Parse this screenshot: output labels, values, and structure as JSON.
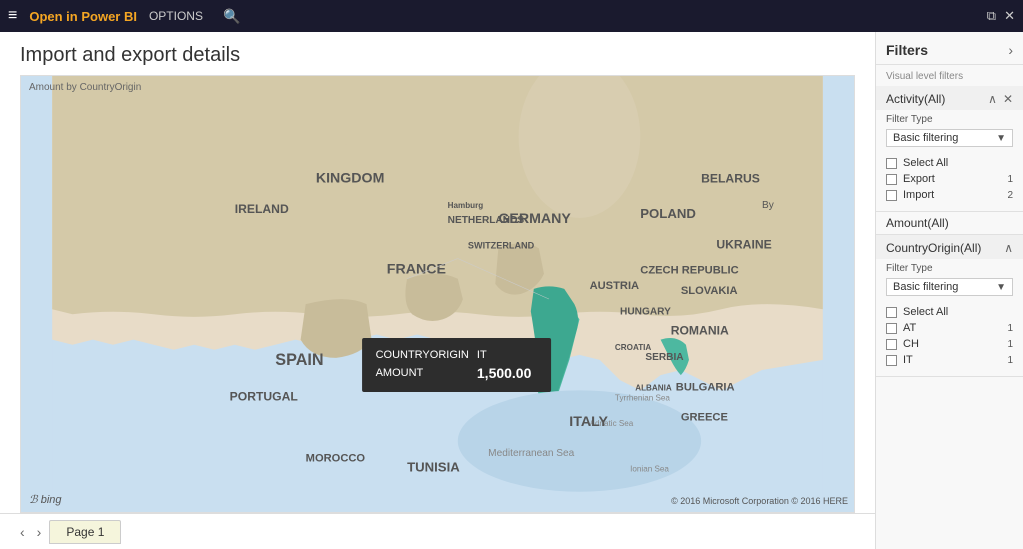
{
  "titlebar": {
    "app_name": "Open in Power BI",
    "options_label": "OPTIONS",
    "search_icon": "🔍",
    "hamburger": "≡",
    "controls": [
      "⧉",
      "✕"
    ]
  },
  "page": {
    "title": "Import and export details",
    "map_label": "Amount by CountryOrigin"
  },
  "map_tooltip": {
    "row1_key": "COUNTRYORIGIN",
    "row1_val": "IT",
    "row2_key": "AMOUNT",
    "row2_val": "1,500.00"
  },
  "map_controls": [
    "⊡",
    "..."
  ],
  "map_bing": "ℬ bing",
  "map_copyright": "© 2016 Microsoft Corporation  © 2016 HERE",
  "tabs": {
    "prev": "‹",
    "next": "›",
    "page": "Page 1"
  },
  "filters": {
    "title": "Filters",
    "arrow": "›",
    "visual_level": "Visual level filters",
    "blocks": [
      {
        "id": "activity",
        "title": "Activity(All)",
        "actions": [
          "∧",
          "✕"
        ],
        "filter_type_label": "Filter Type",
        "filter_type_value": "Basic filtering",
        "items": [
          {
            "label": "Select All",
            "count": ""
          },
          {
            "label": "Export",
            "count": "1"
          },
          {
            "label": "Import",
            "count": "2"
          }
        ]
      },
      {
        "id": "amount",
        "title": "Amount(All)",
        "actions": [],
        "filter_type_label": "",
        "filter_type_value": "",
        "items": []
      },
      {
        "id": "countryorigin",
        "title": "CountryOrigin(All)",
        "actions": [
          "∧"
        ],
        "filter_type_label": "Filter Type",
        "filter_type_value": "Basic filtering",
        "items": [
          {
            "label": "Select All",
            "count": ""
          },
          {
            "label": "AT",
            "count": "1"
          },
          {
            "label": "CH",
            "count": "1"
          },
          {
            "label": "IT",
            "count": "1"
          }
        ]
      }
    ]
  }
}
